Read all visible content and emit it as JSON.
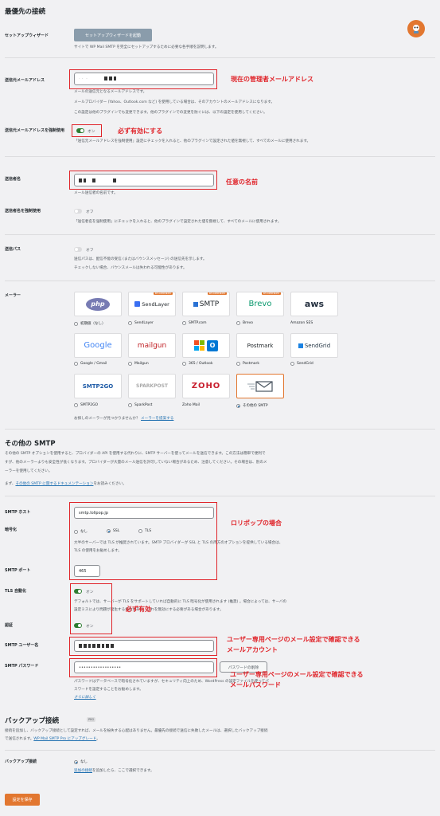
{
  "title": "最優先の接続",
  "setup_wizard": {
    "label": "セットアップウィザード",
    "button": "セットアップウィザードを起動",
    "desc": "サイトで WP Mail SMTP を完全にセットアップするために必要な各手順を説明します。"
  },
  "from_email": {
    "label": "送信元メールアドレス",
    "desc1": "メールの送信元となるメールアドレスです。",
    "desc2": "メールプロバイダー (Yahoo、Outlook.com など) を使用している場合は、そのアカウントのメールアドレスになります。",
    "desc3": "この設定は他のプラグインでも変更できます。他のプラグインでの変更を防ぐには、以下の設定を使用してください。"
  },
  "force_from_email": {
    "label": "送信元メールアドレスを強制使用",
    "toggle": "オン",
    "desc": "「送信元メールアドレスを強制使用」設定にチェックを入れると、他のプラグインで設定された値を無視して、すべてのメールに使用されます。"
  },
  "from_name": {
    "label": "送信者名",
    "desc": "メール送信者の名前です。"
  },
  "force_from_name": {
    "label": "送信者名を強制使用",
    "toggle": "オフ",
    "desc": "「送信者名を強制使用」にチェックを入れると、他のプラグインで設定された値を無視して、すべてのメールに使用されます。"
  },
  "return_path": {
    "label": "送信パス",
    "toggle": "オフ",
    "desc1": "送信パスは、配信不能の受信 (またはバウンスメッセージ) の送信先を示します。",
    "desc2": "チェックしない場合、バウンスメールは失われる可能性があります。"
  },
  "mailer": {
    "label": "メーラー",
    "recommended": "RECOMMENDED",
    "row1": [
      {
        "logo": "php",
        "name": "初期値（なし）"
      },
      {
        "logo": "SendLayer",
        "name": "SendLayer"
      },
      {
        "logo": "SMTP",
        "name": "SMTP.com"
      },
      {
        "logo": "Brevo",
        "name": "Brevo"
      },
      {
        "logo": "aws",
        "name": "Amazon SES"
      }
    ],
    "row2": [
      {
        "logo": "Google",
        "name": "Google / Gmail"
      },
      {
        "logo": "mailgun",
        "name": "Mailgun"
      },
      {
        "logo": "",
        "name": "365 / Outlook"
      },
      {
        "logo": "Postmark",
        "name": "Postmark"
      },
      {
        "logo": "SendGrid",
        "name": "SendGrid"
      }
    ],
    "row3": [
      {
        "logo": "SMTP2GO",
        "name": "SMTP2GO"
      },
      {
        "logo": "SPARKPOST",
        "name": "SparkPost"
      },
      {
        "logo": "ZOHO",
        "name": "Zoho Mail"
      },
      {
        "logo": "",
        "name": "その他の SMTP"
      }
    ],
    "suggest_prefix": "お探しのメーラーが見つかりませんか？",
    "suggest_link": "メーラーを提案する"
  },
  "other_smtp": {
    "title": "その他の SMTP",
    "desc1": "その他の SMTP オプションを使用すると、プロバイダーの API を使用する代わりに、SMTP サーバーを使ってメールを送信できます。この方法は簡単で便利で",
    "desc2": "すが、他のメーラーよりも安全性が低くなります。プロバイダーが大量のメール送信を許可していない場合があるため、注意してください。その場合は、別のメ",
    "desc3": "ーラーを使用してください。",
    "doc_prefix": "まず、",
    "doc_link": "その他の SMTP に関するドキュメンテーション",
    "doc_suffix": "をお読みください。"
  },
  "smtp_host": {
    "label": "SMTP ホスト",
    "value": "smtp.lolipop.jp"
  },
  "encryption": {
    "label": "暗号化",
    "options": [
      "なし",
      "SSL",
      "TLS"
    ],
    "desc1": "大半のサーバーでは TLS が推奨されています。SMTP プロバイダーが SSL と TLS の両方のオプションを提供している場合は、",
    "desc2": "TLS の使用をお勧めします。"
  },
  "smtp_port": {
    "label": "SMTP ポート",
    "value": "465"
  },
  "auto_tls": {
    "label": "TLS 自動化",
    "toggle": "オン",
    "desc1": "デフォルトでは、サーバーが TLS をサポートしていれば自動的に TLS 暗号化が使用されます (推奨) 。場合によっては、サーバの",
    "desc2": "設定ミスにより問題が発生する場合があり、これを無効にする必要がある場合があります。"
  },
  "auth": {
    "label": "認証",
    "toggle": "オン"
  },
  "smtp_user": {
    "label": "SMTP ユーザー名"
  },
  "smtp_pass": {
    "label": "SMTP パスワード",
    "value": "••••••••••••••••••",
    "remove_button": "パスワードの削除",
    "desc1": "パスワードはデータベースで暗号化されていますが、セキュリティ向上のため、WordPress の設定ファイルを使ってパ",
    "desc2": "スワードを設定することをお勧めします。",
    "more": "さらに詳しく"
  },
  "backup": {
    "title": "バックアップ接続",
    "badge": "PRO",
    "desc1": "接続を追加し、バックアップ接続として設定すれば、メールを紛失する心配はありません。最優先の接続で送信に失敗したメールは、選択したバックアップ接続",
    "desc2_prefix": "で送信されます。",
    "desc2_link": "WP Mail SMTP Pro にアップグレード",
    "desc2_suffix": "。",
    "label": "バックアップ接続",
    "option": "なし",
    "hint_link": "追加の接続",
    "hint_suffix": "を追加したら、ここで選択できます。"
  },
  "save_button": "設定を保存",
  "annotations": {
    "admin_email": "現在の管理者メールアドレス",
    "must_enable": "必ず有効にする",
    "any_name": "任意の名前",
    "lolipop": "ロリポップの場合",
    "must_enable2": "必ず有効",
    "user_page_account1": "ユーザー専用ページのメール設定で確認できる",
    "user_page_account2": "メールアカウント",
    "user_page_pass1": "ユーザー専用ページのメール設定で確認できる",
    "user_page_pass2": "メールパスワード"
  },
  "colors": {
    "accent": "#e27730",
    "annotation": "#e0242a",
    "toggle_on": "#2e7d32",
    "link": "#2271b1"
  }
}
